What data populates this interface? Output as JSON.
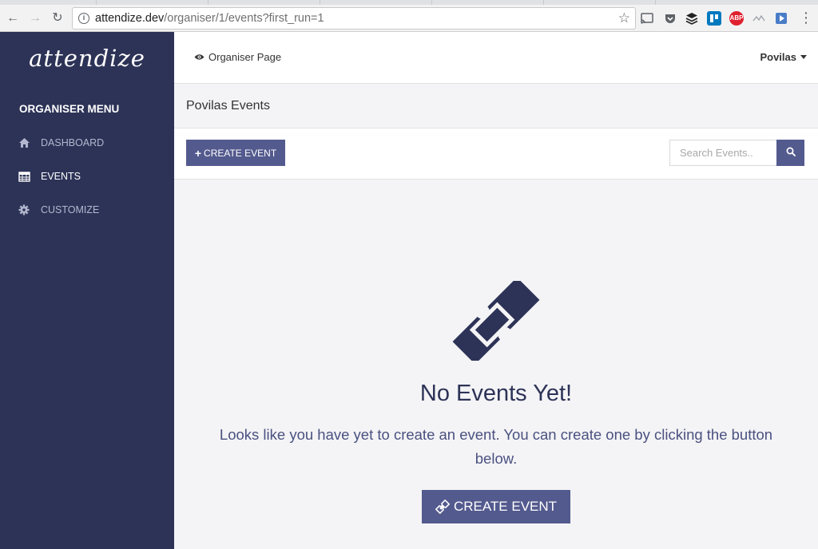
{
  "browser": {
    "url_host": "attendize.dev",
    "url_rest": "/organiser/1/events?first_run=1",
    "extensions": [
      "cast-icon",
      "pocket-icon",
      "buffer-icon",
      "trello-icon",
      "adblock-icon",
      "link-icon",
      "play-icon"
    ],
    "adblock_label": "ABP"
  },
  "sidebar": {
    "logo": "attendize",
    "menu_title": "ORGANISER MENU",
    "items": [
      {
        "label": "DASHBOARD",
        "icon": "home-icon"
      },
      {
        "label": "EVENTS",
        "icon": "calendar-icon"
      },
      {
        "label": "CUSTOMIZE",
        "icon": "gear-icon"
      }
    ]
  },
  "topbar": {
    "organiser_page": "Organiser Page",
    "user": "Povilas"
  },
  "page": {
    "title": "Povilas Events"
  },
  "actions": {
    "create_label": "CREATE EVENT",
    "search_placeholder": "Search Events.."
  },
  "empty_state": {
    "title": "No Events Yet!",
    "text": "Looks like you have yet to create an event. You can create one by clicking the button below.",
    "button_label": "CREATE EVENT"
  },
  "colors": {
    "sidebar_bg": "#2d3357",
    "accent": "#535a8e",
    "content_bg": "#f4f4f6"
  }
}
